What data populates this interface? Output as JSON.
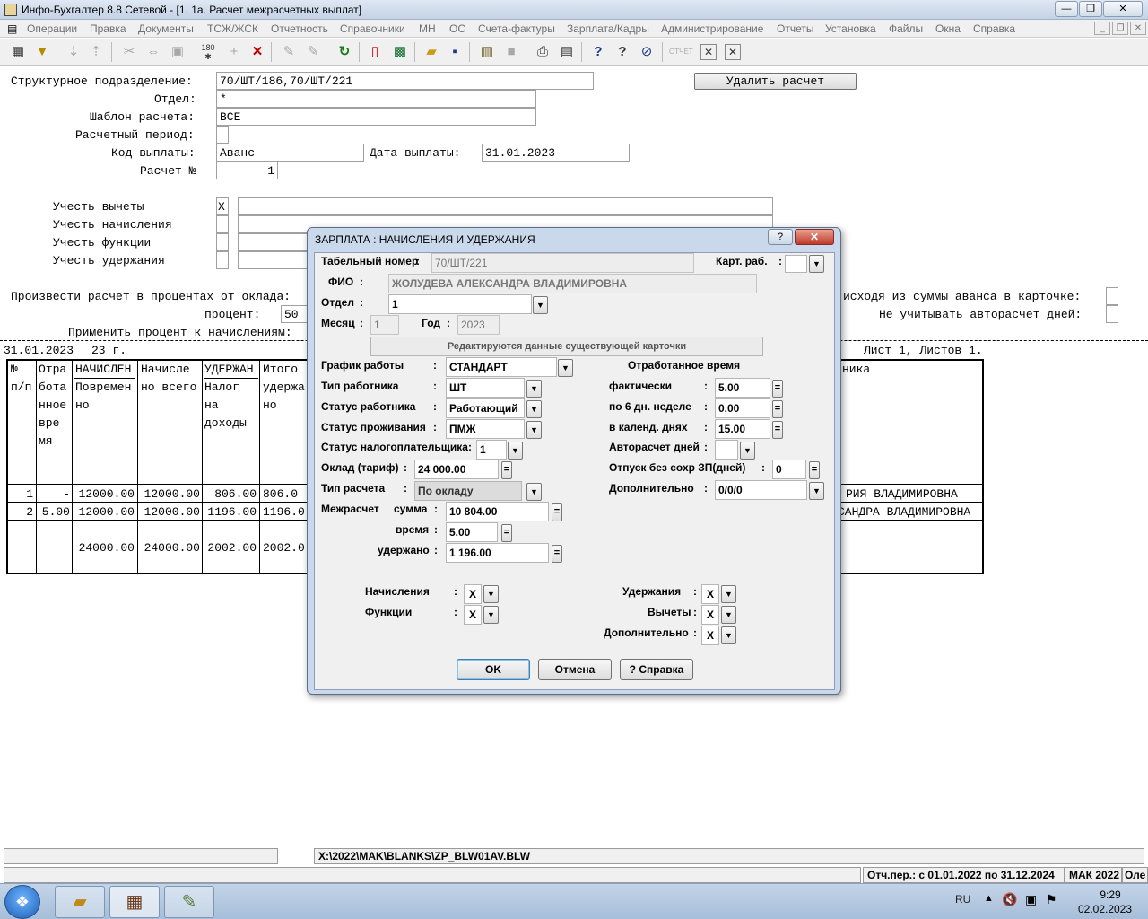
{
  "window": {
    "title": "Инфо-Бухгалтер 8.8 Сетевой - [1. 1а. Расчет межрасчетных выплат]"
  },
  "menu": [
    "Операции",
    "Правка",
    "Документы",
    "ТСЖ/ЖСК",
    "Отчетность",
    "Справочники",
    "МН",
    "ОС",
    "Счета-фактуры",
    "Зарплата/Кадры",
    "Администрирование",
    "Отчеты",
    "Установка",
    "Файлы",
    "Окна",
    "Справка"
  ],
  "toolbar_icons": [
    "calendar-icon",
    "filter-icon",
    "sort-down-icon",
    "sort-up-icon",
    "cut-icon",
    "move-icon",
    "paste-icon",
    "number-icon",
    "add-icon",
    "delete-icon",
    "tool-icon",
    "tool2-icon",
    "refresh-icon",
    "export-icon",
    "calculator-icon",
    "open-icon",
    "save-icon",
    "archive-icon",
    "disk-icon",
    "print-icon",
    "preview-icon",
    "help-icon",
    "whatsthis-icon",
    "compass-icon",
    "report-icon",
    "close-x-icon",
    "close-x2-icon"
  ],
  "form": {
    "dept_label": "Структурное подразделение:",
    "dept_value": "70/ШТ/186,70/ШТ/221",
    "otdel_label": "Отдел:",
    "otdel_value": "*",
    "template_label": "Шаблон расчета:",
    "template_value": "ВСЕ",
    "period_label": "Расчетный период:",
    "period_value": "",
    "paycode_label": "Код выплаты:",
    "paycode_value": "Аванс",
    "paydate_label": "Дата выплаты:",
    "paydate_value": "31.01.2023",
    "calc_label": "Расчет №",
    "calc_value": "1",
    "delete_button": "Удалить расчет",
    "ded_label": "Учесть вычеты",
    "ded_value": "X",
    "acc_label": "Учесть начисления",
    "func_label": "Учесть функции",
    "hold_label": "Учесть удержания",
    "percent_line": "Произвести расчет в процентах от оклада:",
    "percent_label": "процент:",
    "percent_value": "50",
    "apply_percent": "Применить процент к начислениям:",
    "advance_from_card": "исходя из суммы аванса в карточке:",
    "no_autocalc": "Не учитывать авторасчет дней:",
    "report_date": "31.01.2023",
    "report_suffix": "23 г.",
    "sheet": "Лист 1, Листов 1."
  },
  "grid": {
    "header": {
      "c1": [
        "№",
        "п/п"
      ],
      "c2": [
        "Отра",
        "бота",
        "нное",
        "вре",
        "мя"
      ],
      "c3": [
        "НАЧИСЛЕН",
        "Повремен",
        "но"
      ],
      "c4": [
        "Начисле",
        "но всего"
      ],
      "c5": [
        "УДЕРЖАН",
        "Налог",
        "на",
        "доходы"
      ],
      "c6": [
        "Итого",
        "удержа",
        "но"
      ],
      "c7": "ника"
    },
    "rows": [
      {
        "n": "1",
        "time": "-",
        "accr": "12000.00",
        "total": "12000.00",
        "tax": "806.00",
        "held": "806.0",
        "name": "РИЯ ВЛАДИМИРОВНА"
      },
      {
        "n": "2",
        "time": "5.00",
        "accr": "12000.00",
        "total": "12000.00",
        "tax": "1196.00",
        "held": "1196.0",
        "name": "САНДРА ВЛАДИМИРОВНА"
      }
    ],
    "totals": {
      "accr": "24000.00",
      "total": "24000.00",
      "tax": "2002.00",
      "held": "2002.0"
    }
  },
  "dialog": {
    "title": "ЗАРПЛАТА : НАЧИСЛЕНИЯ И УДЕРЖАНИЯ",
    "tab_label": "Табельный номер",
    "tab_value": "70/ШТ/221",
    "card_label": "Карт. раб.",
    "fio_label": "ФИО",
    "fio_value": "ЖОЛУДЕВА АЛЕКСАНДРА ВЛАДИМИРОВНА",
    "otdel_label": "Отдел",
    "otdel_value": "1",
    "month_label": "Месяц",
    "month_value": "1",
    "year_label": "Год",
    "year_value": "2023",
    "edit_note": "Редактируются данные существующей карточки",
    "schedule_label": "График работы",
    "schedule_value": "СТАНДАРТ",
    "worktype_label": "Тип работника",
    "worktype_value": "ШТ",
    "status_label": "Статус работника",
    "status_value": "Работающий",
    "residence_label": "Статус проживания",
    "residence_value": "ПМЖ",
    "taxpayer_label": "Статус налогоплательщика",
    "taxpayer_value": "1",
    "salary_label": "Оклад (тариф)",
    "salary_value": "24 000.00",
    "calctype_label": "Тип расчета",
    "calctype_value": "По окладу",
    "mezh_label": "Межрасчет",
    "sum_label": "сумма",
    "sum_value": "10 804.00",
    "time_label": "время",
    "time_value": "5.00",
    "held_label": "удержано",
    "held_value": "1 196.00",
    "worked_title": "Отработанное время",
    "fact_label": "фактически",
    "fact_value": "5.00",
    "six_label": "по 6 дн. неделе",
    "six_value": "0.00",
    "cal_label": "в календ. днях",
    "cal_value": "15.00",
    "autodays_label": "Авторасчет дней",
    "unpaid_label": "Отпуск без сохр ЗП(дней)",
    "unpaid_value": "0",
    "extra_label": "Дополнительно",
    "extra_value": "0/0/0",
    "accr_label": "Начисления",
    "accr_value": "X",
    "func_label": "Функции",
    "func_value": "X",
    "hold_label": "Удержания",
    "hold_value": "X",
    "ded_label": "Вычеты",
    "ded_value": "X",
    "add_label": "Дополнительно",
    "add_value": "X",
    "ok": "OK",
    "cancel": "Отмена",
    "help": "? Справка"
  },
  "status": {
    "path": "X:\\2022\\MAK\\BLANKS\\ZP_BLW01AV.BLW",
    "period": "Отч.пер.: с 01.01.2022 по 31.12.2024",
    "org": "МАК 2022",
    "extra": "Оле"
  },
  "taskbar": {
    "lang": "RU",
    "time": "9:29",
    "date": "02.02.2023"
  }
}
